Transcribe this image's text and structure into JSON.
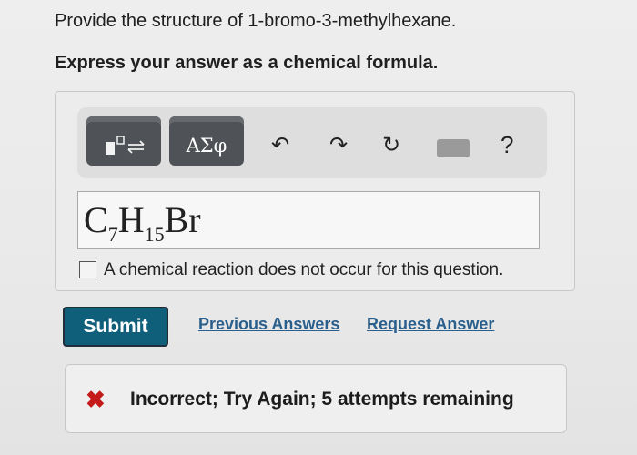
{
  "question": {
    "text": "Provide the structure of 1-bromo-3-methylhexane.",
    "instruction": "Express your answer as a chemical formula."
  },
  "toolbar": {
    "templates_icon": "templates-icon",
    "greek_label": "AΣφ",
    "undo_icon": "↶",
    "redo_icon": "↷",
    "reset_icon": "↻",
    "keyboard_icon": "keyboard-icon",
    "help_label": "?"
  },
  "answer": {
    "elem1": "C",
    "sub1": "7",
    "elem2": "H",
    "sub2": "15",
    "elem3": "Br"
  },
  "no_reaction_label": "A chemical reaction does not occur for this question.",
  "buttons": {
    "submit": "Submit",
    "previous_answers": "Previous Answers",
    "request_answer": "Request Answer"
  },
  "feedback": {
    "icon": "✖",
    "text": "Incorrect; Try Again; 5 attempts remaining"
  },
  "colors": {
    "submit_bg": "#0f5f7a",
    "link": "#2a5f8c",
    "error": "#c41a1a"
  }
}
